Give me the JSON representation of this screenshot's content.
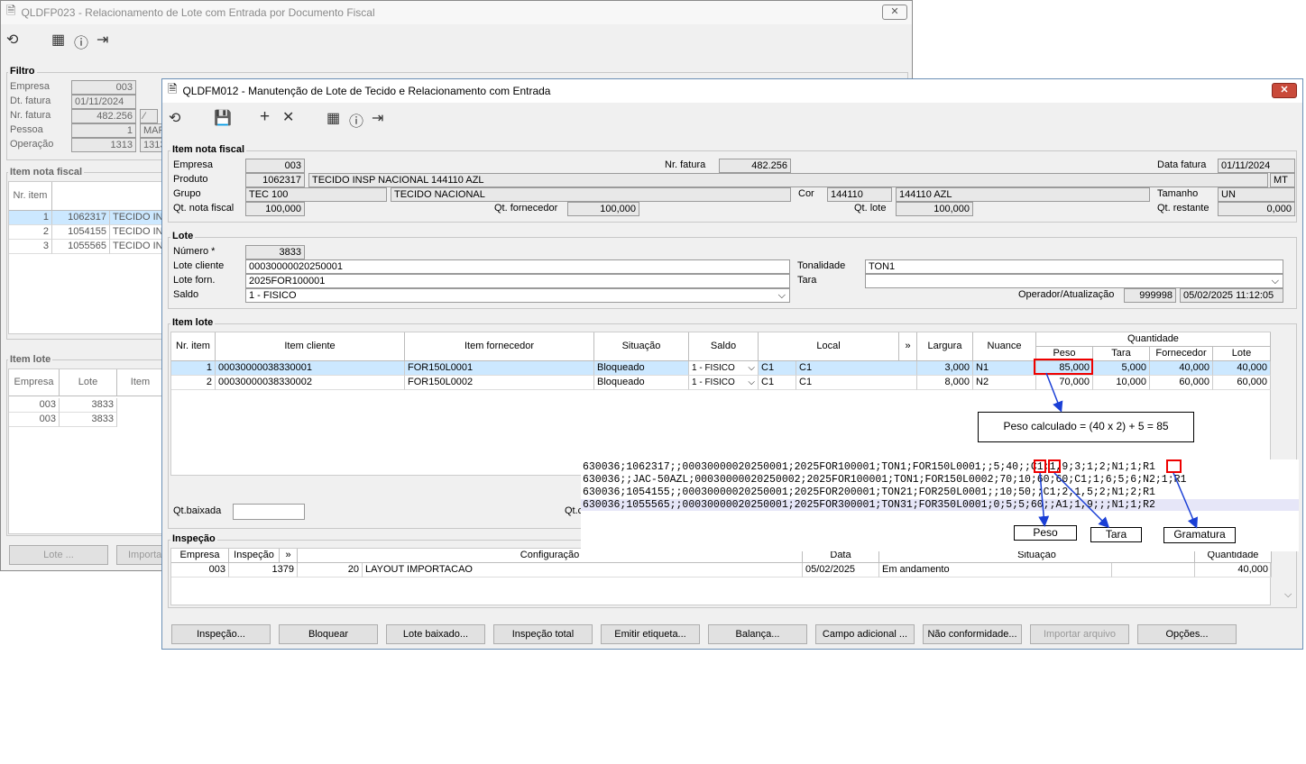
{
  "back_window": {
    "title": "QLDFP023 - Relacionamento de Lote com Entrada por Documento Fiscal",
    "filtro": {
      "label": "Filtro",
      "empresa_lbl": "Empresa",
      "empresa": "003",
      "dt_fatura_lbl": "Dt. fatura",
      "dt_fatura": "01/11/2024",
      "nr_fatura_lbl": "Nr. fatura",
      "nr_fatura": "482.256",
      "pessoa_lbl": "Pessoa",
      "pessoa": "1",
      "pessoa_name": "MAR",
      "operacao_lbl": "Operação",
      "operacao": "1313",
      "operacao_2": "1313"
    },
    "item_nf": {
      "label": "Item nota fiscal",
      "col_nr": "Nr. item",
      "rows": [
        {
          "nr": "1",
          "code": "1062317",
          "desc": "TECIDO INSI"
        },
        {
          "nr": "2",
          "code": "1054155",
          "desc": "TECIDO INSI"
        },
        {
          "nr": "3",
          "code": "1055565",
          "desc": "TECIDO INSI"
        }
      ]
    },
    "item_lote": {
      "label": "Item lote",
      "col_empresa": "Empresa",
      "col_lote": "Lote",
      "col_item": "Item",
      "rows": [
        {
          "empresa": "003",
          "lote": "3833"
        },
        {
          "empresa": "003",
          "lote": "3833"
        }
      ]
    },
    "btn_lote": "Lote ...",
    "btn_importar": "Importar"
  },
  "main": {
    "title": "QLDFM012 - Manutenção de Lote de Tecido e Relacionamento com Entrada",
    "close": "✕",
    "item_nf": {
      "label": "Item nota fiscal",
      "empresa_lbl": "Empresa",
      "empresa": "003",
      "nr_fatura_lbl": "Nr. fatura",
      "nr_fatura": "482.256",
      "data_fatura_lbl": "Data fatura",
      "data_fatura": "01/11/2024",
      "produto_lbl": "Produto",
      "produto_code": "1062317",
      "produto_desc": "TECIDO INSP NACIONAL 144110 AZL",
      "unidade": "MT",
      "grupo_lbl": "Grupo",
      "grupo_code": "TEC 100",
      "grupo_desc": "TECIDO NACIONAL",
      "cor_lbl": "Cor",
      "cor_code": "144110",
      "cor_desc": "144110 AZL",
      "tamanho_lbl": "Tamanho",
      "tamanho": "UN",
      "qt_nf_lbl": "Qt. nota fiscal",
      "qt_nf": "100,000",
      "qt_forn_lbl": "Qt. fornecedor",
      "qt_forn": "100,000",
      "qt_lote_lbl": "Qt. lote",
      "qt_lote": "100,000",
      "qt_rest_lbl": "Qt. restante",
      "qt_rest": "0,000"
    },
    "lote": {
      "label": "Lote",
      "numero_lbl": "Número *",
      "numero": "3833",
      "lote_cliente_lbl": "Lote cliente",
      "lote_cliente": "00030000020250001",
      "lote_forn_lbl": "Lote forn.",
      "lote_forn": "2025FOR100001",
      "saldo_lbl": "Saldo",
      "saldo": "1 - FISICO",
      "tonalidade_lbl": "Tonalidade",
      "tonalidade": "TON1",
      "tara_lbl": "Tara",
      "tara": "",
      "operador_lbl": "Operador/Atualização",
      "operador": "999998",
      "atualizacao": "05/02/2025 11:12:05"
    },
    "item_lote": {
      "label": "Item lote",
      "cols": {
        "nr_item": "Nr. item",
        "item_cliente": "Item cliente",
        "item_fornecedor": "Item fornecedor",
        "situacao": "Situação",
        "saldo": "Saldo",
        "local": "Local",
        "more": "»",
        "largura": "Largura",
        "nuance": "Nuance",
        "quantidade": "Quantidade",
        "peso": "Peso",
        "tara": "Tara",
        "fornecedor": "Fornecedor",
        "lote": "Lote"
      },
      "rows": [
        {
          "nr": "1",
          "cliente": "00030000038330001",
          "fornecedor": "FOR150L0001",
          "situacao": "Bloqueado",
          "saldo": "1 - FISICO",
          "local1": "C1",
          "local2": "C1",
          "largura": "3,000",
          "nuance": "N1",
          "peso": "85,000",
          "tara": "5,000",
          "q_forn": "40,000",
          "q_lote": "40,000"
        },
        {
          "nr": "2",
          "cliente": "00030000038330002",
          "fornecedor": "FOR150L0002",
          "situacao": "Bloqueado",
          "saldo": "1 - FISICO",
          "local1": "C1",
          "local2": "C1",
          "largura": "8,000",
          "nuance": "N2",
          "peso": "70,000",
          "tara": "10,000",
          "q_forn": "60,000",
          "q_lote": "60,000"
        }
      ],
      "qt_baixada_lbl": "Qt.baixada",
      "qt_partial_lbl": "Qt.c"
    },
    "inspecao": {
      "label": "Inspeção",
      "cols": {
        "empresa": "Empresa",
        "inspecao": "Inspeção",
        "more": "»",
        "configuracao": "Configuração",
        "data": "Data",
        "situacao": "Situação",
        "quantidade": "Quantidade"
      },
      "row": {
        "empresa": "003",
        "inspecao": "1379",
        "cfg_code": "20",
        "cfg_desc": "LAYOUT IMPORTACAO",
        "data": "05/02/2025",
        "situacao": "Em andamento",
        "quantidade": "40,000"
      }
    },
    "buttons": [
      "Inspeção...",
      "Bloquear",
      "Lote baixado...",
      "Inspeção total",
      "Emitir etiqueta...",
      "Balança...",
      "Campo adicional ...",
      "Não conformidade...",
      "Importar arquivo",
      "Opções..."
    ]
  },
  "annotation": {
    "formula": "Peso calculado = (40 x 2) + 5 = 85",
    "lines": [
      "630036;1062317;;00030000020250001;2025FOR100001;TON1;FOR150L0001;;5;40;;C1;1,9;3;1;2;N1;1;R1",
      "630036;;JAC-50AZL;00030000020250002;2025FOR100001;TON1;FOR150L0002;70;10;60;60;C1;1;6;5;6;N2;1;R1",
      "630036;1054155;;00030000020250001;2025FOR200001;TON21;FOR250L0001;;10;50;;C1;2;1,5;2;N1;2;R1",
      "630036;1055565;;00030000020250001;2025FOR300001;TON31;FOR350L0001;0;5;5;60;;A1;1,9;;;N1;1;R2"
    ],
    "labels": {
      "peso": "Peso",
      "tara": "Tara",
      "gramatura": "Gramatura"
    },
    "colors": {
      "highlight": "#e00000",
      "arrow": "#1a3fd6"
    }
  }
}
